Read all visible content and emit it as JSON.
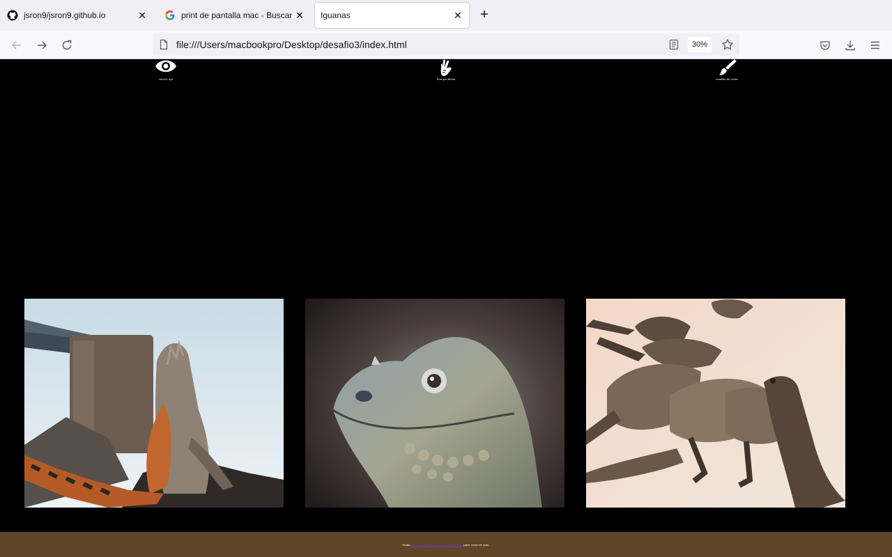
{
  "browser": {
    "tabs": [
      {
        "title": "jsron9/jsron9.github.io",
        "active": false,
        "icon": "github-icon"
      },
      {
        "title": "print de pantalla mac - Buscar c",
        "active": false,
        "icon": "google-icon"
      },
      {
        "title": "Iguanas",
        "active": true,
        "icon": ""
      }
    ],
    "new_tab_label": "+",
    "url": "file:///Users/macbookpro/Desktop/desafio3/index.html",
    "zoom": "30%"
  },
  "page": {
    "features": [
      {
        "icon": "eye-icon",
        "caption": "tercer ojo"
      },
      {
        "icon": "peace-hand-icon",
        "caption": "Son pacificas"
      },
      {
        "icon": "paintbrush-icon",
        "caption": "cambia de color"
      }
    ],
    "photos": [
      {
        "name": "iguana-on-rock-photo"
      },
      {
        "name": "iguana-head-closeup-photo"
      },
      {
        "name": "iguanas-on-beach-photo"
      }
    ],
    "footer": {
      "prefix": "Visita",
      "link": "www.iguanasdelmundo.com/iguanas",
      "suffix": "para conocer más."
    }
  },
  "colors": {
    "page_bg": "#000000",
    "footer_bg": "#5d4526",
    "link": "#6b3fd4"
  }
}
